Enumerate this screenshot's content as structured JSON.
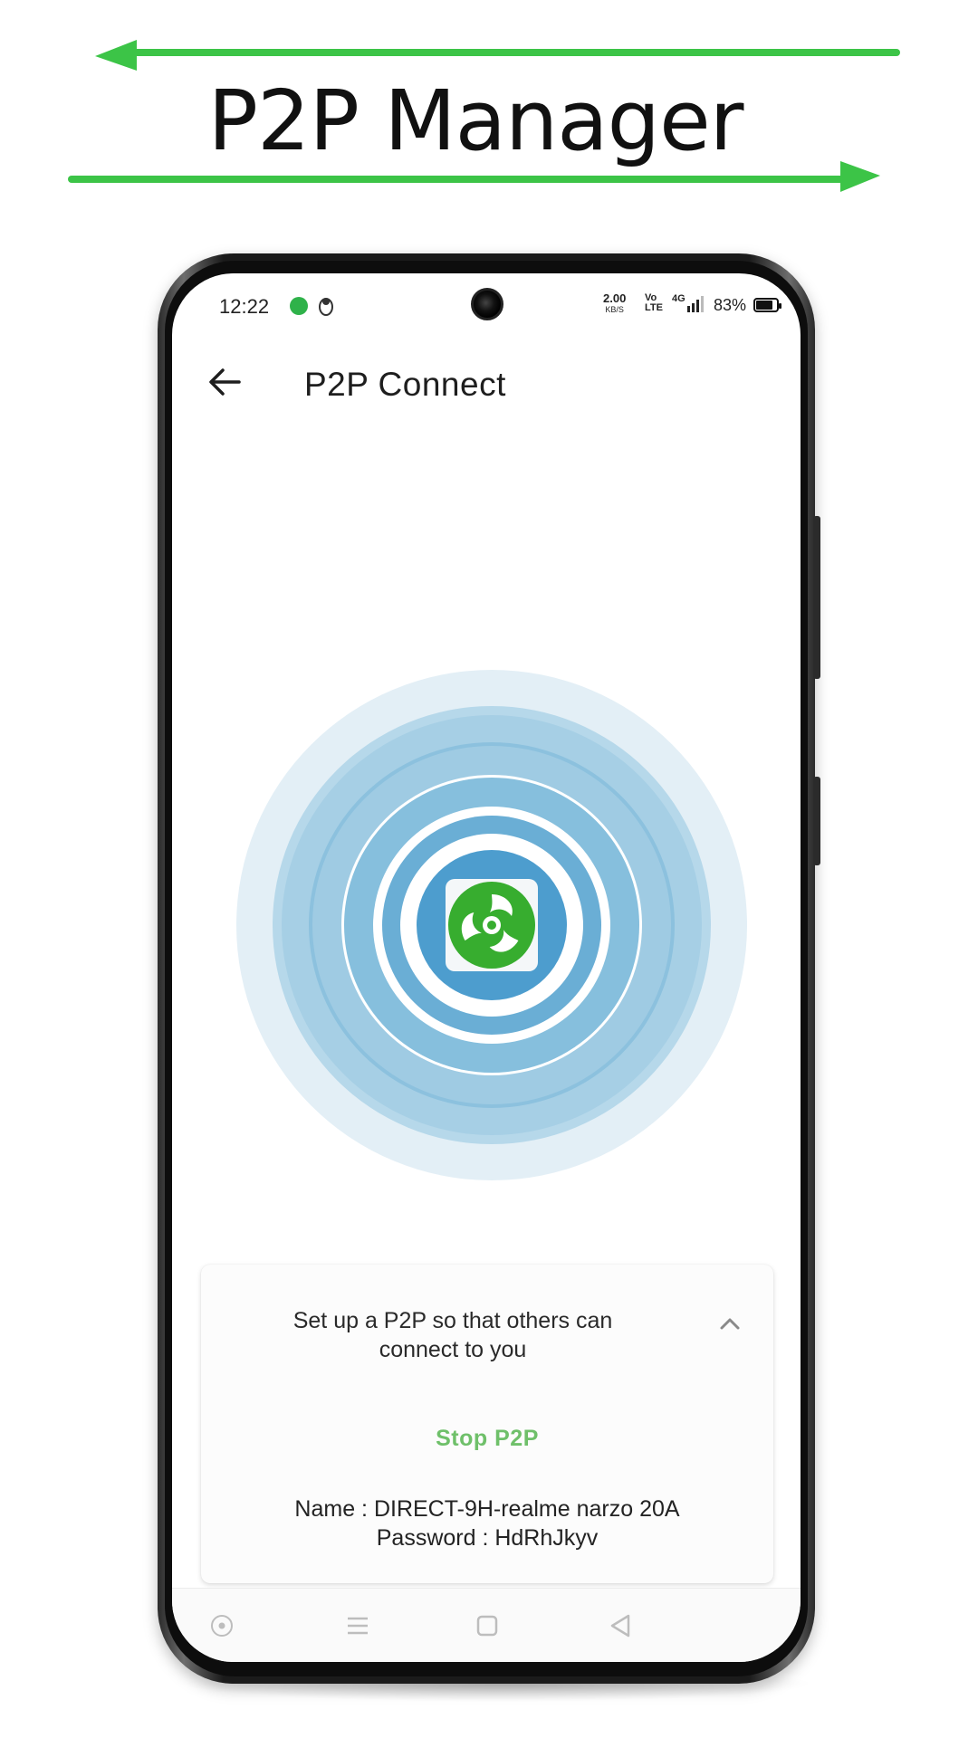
{
  "banner": {
    "title": "P2P Manager",
    "arrow_color": "#3cc447"
  },
  "status_bar": {
    "time": "12:22",
    "net_speed_value": "2.00",
    "net_speed_unit": "KB/S",
    "volte_top": "Vo",
    "volte_bottom": "LTE",
    "network_type": "4G",
    "battery_percent": "83%",
    "battery_level": 0.83
  },
  "app_bar": {
    "title": "P2P Connect"
  },
  "radar": {
    "accent": "#3d9acb",
    "logo_color": "#37ad2f"
  },
  "card": {
    "description_line1": "Set up a P2P so that others can",
    "description_line2": "connect to you",
    "stop_label": "Stop P2P",
    "name_line": "Name : DIRECT-9H-realme narzo 20A",
    "password_line": "Password : HdRhJkyv",
    "stop_color": "#6fc06a"
  },
  "nav_bar": {
    "icons": [
      "circle-dot-icon",
      "menu-icon",
      "home-square-icon",
      "back-triangle-icon"
    ]
  }
}
